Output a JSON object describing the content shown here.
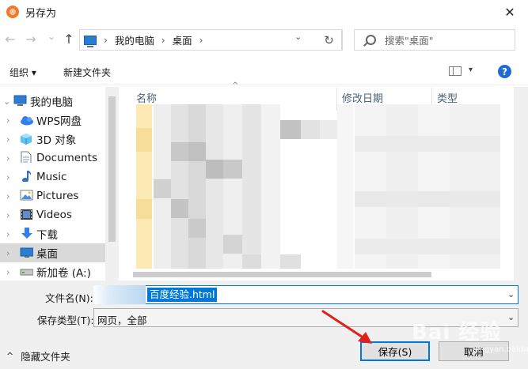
{
  "window": {
    "title": "另存为",
    "close_glyph": "✕"
  },
  "nav": {
    "back_glyph": "←",
    "forward_glyph": "→",
    "recent_glyph": "⌄",
    "up_glyph": "↑",
    "breadcrumb": [
      "我的电脑",
      "桌面"
    ],
    "crumb_sep": "›",
    "dropdown_glyph": "⌄",
    "refresh_glyph": "↻",
    "search_placeholder": "搜索\"桌面\""
  },
  "toolbar": {
    "organize_label": "组织 ▾",
    "new_folder_label": "新建文件夹",
    "view_drop_glyph": "▾",
    "help_glyph": "?"
  },
  "tree": [
    {
      "label": "我的电脑",
      "icon": "computer-icon",
      "expand": "⌄",
      "selected": false
    },
    {
      "label": "WPS网盘",
      "icon": "cloud-icon",
      "expand": "›",
      "selected": false
    },
    {
      "label": "3D 对象",
      "icon": "cube-3d-icon",
      "expand": "›",
      "selected": false
    },
    {
      "label": "Documents",
      "icon": "document-icon",
      "expand": "›",
      "selected": false
    },
    {
      "label": "Music",
      "icon": "music-note-icon",
      "expand": "›",
      "selected": false
    },
    {
      "label": "Pictures",
      "icon": "picture-icon",
      "expand": "›",
      "selected": false
    },
    {
      "label": "Videos",
      "icon": "video-icon",
      "expand": "›",
      "selected": false
    },
    {
      "label": "下载",
      "icon": "download-arrow-icon",
      "expand": "›",
      "selected": false
    },
    {
      "label": "桌面",
      "icon": "desktop-icon",
      "expand": "›",
      "selected": true
    },
    {
      "label": "新加卷 (A:)",
      "icon": "drive-icon",
      "expand": "›",
      "selected": false
    }
  ],
  "columns": [
    {
      "label": "名称"
    },
    {
      "label": "修改日期"
    },
    {
      "label": "类型"
    }
  ],
  "sort_glyph": "^",
  "filename": {
    "label": "文件名(N):",
    "value": "百度经验.html",
    "dropdown_glyph": "⌄"
  },
  "filetype": {
    "label": "保存类型(T):",
    "value": "网页，全部",
    "dropdown_glyph": "⌄"
  },
  "hide_folders": {
    "label": "隐藏文件夹",
    "glyph": "^"
  },
  "buttons": {
    "save": "保存(S)",
    "cancel": "取消"
  },
  "watermark": {
    "text": "Bai 经验",
    "sub": "jingyan.baidu.com"
  },
  "colors": {
    "accent": "#0078d7",
    "annotation": "#e0201b",
    "folder": "#f8dc8a"
  }
}
